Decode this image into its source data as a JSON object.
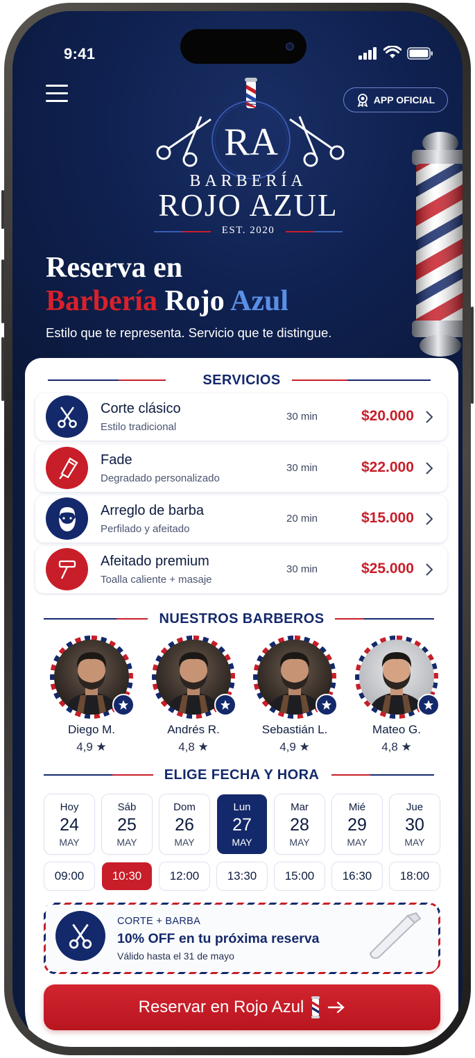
{
  "status_bar": {
    "time": "9:41"
  },
  "header": {
    "official_badge": "APP OFICIAL"
  },
  "logo": {
    "monogram": "RA",
    "brand_top": "BARBERÍA",
    "brand_main": "ROJO AZUL",
    "established": "EST. 2020"
  },
  "hero": {
    "title_line1": "Reserva en",
    "title_word_red": "Barbería",
    "title_word_white": "Rojo",
    "title_word_blue": "Azul",
    "subtitle": "Estilo que te representa. Servicio que te distingue."
  },
  "services": {
    "heading": "SERVICIOS",
    "items": [
      {
        "name": "Corte clásico",
        "desc": "Estilo tradicional",
        "duration": "30 min",
        "price": "$20.000",
        "icon": "scissors-icon",
        "color": "#14296b"
      },
      {
        "name": "Fade",
        "desc": "Degradado personalizado",
        "duration": "30 min",
        "price": "$22.000",
        "icon": "clipper-icon",
        "color": "#c81e29"
      },
      {
        "name": "Arreglo de barba",
        "desc": "Perfilado y afeitado",
        "duration": "20 min",
        "price": "$15.000",
        "icon": "beard-icon",
        "color": "#14296b"
      },
      {
        "name": "Afeitado premium",
        "desc": "Toalla caliente + masaje",
        "duration": "30 min",
        "price": "$25.000",
        "icon": "razor-icon",
        "color": "#c81e29"
      }
    ]
  },
  "barbers": {
    "heading": "NUESTROS BARBEROS",
    "items": [
      {
        "name": "Diego M.",
        "rating": "4,9 ★"
      },
      {
        "name": "Andrés R.",
        "rating": "4,8 ★"
      },
      {
        "name": "Sebastián L.",
        "rating": "4,9 ★"
      },
      {
        "name": "Mateo G.",
        "rating": "4,8 ★"
      }
    ]
  },
  "schedule": {
    "heading": "ELIGE FECHA Y HORA",
    "days": [
      {
        "dow": "Hoy",
        "day": "24",
        "month": "MAY",
        "selected": false
      },
      {
        "dow": "Sáb",
        "day": "25",
        "month": "MAY",
        "selected": false
      },
      {
        "dow": "Dom",
        "day": "26",
        "month": "MAY",
        "selected": false
      },
      {
        "dow": "Lun",
        "day": "27",
        "month": "MAY",
        "selected": true
      },
      {
        "dow": "Mar",
        "day": "28",
        "month": "MAY",
        "selected": false
      },
      {
        "dow": "Mié",
        "day": "29",
        "month": "MAY",
        "selected": false
      },
      {
        "dow": "Jue",
        "day": "30",
        "month": "MAY",
        "selected": false
      }
    ],
    "times": [
      {
        "label": "09:00",
        "selected": false
      },
      {
        "label": "10:30",
        "selected": true
      },
      {
        "label": "12:00",
        "selected": false
      },
      {
        "label": "13:30",
        "selected": false
      },
      {
        "label": "15:00",
        "selected": false
      },
      {
        "label": "16:30",
        "selected": false
      },
      {
        "label": "18:00",
        "selected": false
      }
    ]
  },
  "promo": {
    "kicker": "CORTE + BARBA",
    "headline": "10% OFF en tu próxima reserva",
    "validity": "Válido hasta el 31 de mayo"
  },
  "cta": {
    "label": "Reservar en Rojo Azul"
  },
  "colors": {
    "navy": "#14296b",
    "red": "#c81e29",
    "hero_bg": "#0f2150",
    "accent_blue": "#5a8fe6"
  }
}
